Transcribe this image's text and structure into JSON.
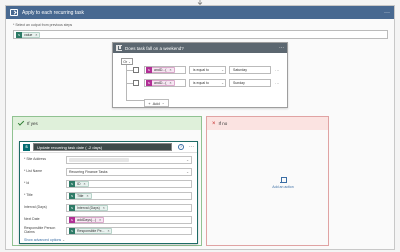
{
  "apply_each": {
    "title": "Apply to each recurring task",
    "select_label": "* Select an output from previous steps",
    "token": {
      "label": "value",
      "icon": "sharepoint-icon"
    }
  },
  "condition": {
    "title": "Does task fall on a weekend?",
    "group_operator": "Or",
    "rows": [
      {
        "token": "andD...(",
        "operator": "is equal to",
        "value": "Saturday"
      },
      {
        "token": "andD...(",
        "operator": "is equal to",
        "value": "Sunday"
      }
    ],
    "add_label": "Add"
  },
  "branches": {
    "yes_title": "If yes",
    "no_title": "If no",
    "add_action_label": "Add an action"
  },
  "update": {
    "title": "Update recurring task date ( -2 days)",
    "fields": [
      {
        "label": "* Site Address",
        "value": ""
      },
      {
        "label": "* List Name",
        "value": "Recurring Finance Tasks"
      },
      {
        "label": "* Id",
        "token": "ID"
      },
      {
        "label": "* Title",
        "token": "Title"
      },
      {
        "label": "Interval (Days)",
        "token": "Interval (Days)"
      },
      {
        "label": "Next Date",
        "token": "addDays(...)",
        "pink": true
      },
      {
        "label": "Responsible Person Claims",
        "token": "Responsible Pe..."
      }
    ],
    "show_advanced": "Show advanced options"
  },
  "colors": {
    "apply_header": "#486991",
    "condition_header": "#5c6770",
    "yes_header": "#dff0da",
    "no_header": "#fbe3e1",
    "sharepoint": "#036c70",
    "expression_token": "#b12f95"
  }
}
